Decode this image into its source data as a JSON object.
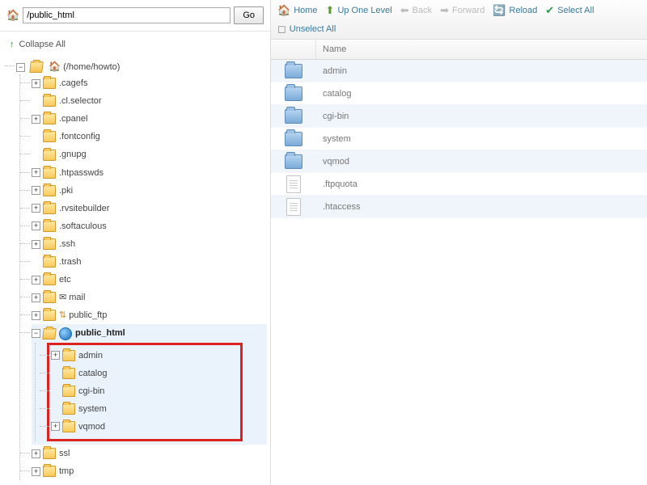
{
  "path": {
    "value": "/public_html",
    "go_label": "Go"
  },
  "collapse_label": "Collapse All",
  "tree": {
    "root_label": "(/home/howto)",
    "items": [
      {
        "label": ".cagefs",
        "expandable": true
      },
      {
        "label": ".cl.selector",
        "expandable": false
      },
      {
        "label": ".cpanel",
        "expandable": true
      },
      {
        "label": ".fontconfig",
        "expandable": false
      },
      {
        "label": ".gnupg",
        "expandable": false
      },
      {
        "label": ".htpasswds",
        "expandable": true
      },
      {
        "label": ".pki",
        "expandable": true
      },
      {
        "label": ".rvsitebuilder",
        "expandable": true
      },
      {
        "label": ".softaculous",
        "expandable": true
      },
      {
        "label": ".ssh",
        "expandable": true
      },
      {
        "label": ".trash",
        "expandable": false
      },
      {
        "label": "etc",
        "expandable": true
      },
      {
        "label": "mail",
        "expandable": true,
        "icon": "mail"
      },
      {
        "label": "public_ftp",
        "expandable": true,
        "icon": "ftp"
      }
    ],
    "public_html_label": "public_html",
    "public_html_children": [
      {
        "label": "admin",
        "expandable": true
      },
      {
        "label": "catalog",
        "expandable": false
      },
      {
        "label": "cgi-bin",
        "expandable": false
      },
      {
        "label": "system",
        "expandable": false
      },
      {
        "label": "vqmod",
        "expandable": true
      }
    ],
    "after": [
      {
        "label": "ssl",
        "expandable": true
      },
      {
        "label": "tmp",
        "expandable": true
      }
    ]
  },
  "toolbar": {
    "home": "Home",
    "up": "Up One Level",
    "back": "Back",
    "forward": "Forward",
    "reload": "Reload",
    "select_all": "Select All",
    "unselect_all": "Unselect All"
  },
  "filelist": {
    "header_name": "Name",
    "rows": [
      {
        "name": "admin",
        "type": "folder"
      },
      {
        "name": "catalog",
        "type": "folder"
      },
      {
        "name": "cgi-bin",
        "type": "folder"
      },
      {
        "name": "system",
        "type": "folder"
      },
      {
        "name": "vqmod",
        "type": "folder"
      },
      {
        "name": ".ftpquota",
        "type": "file"
      },
      {
        "name": ".htaccess",
        "type": "file"
      }
    ]
  }
}
